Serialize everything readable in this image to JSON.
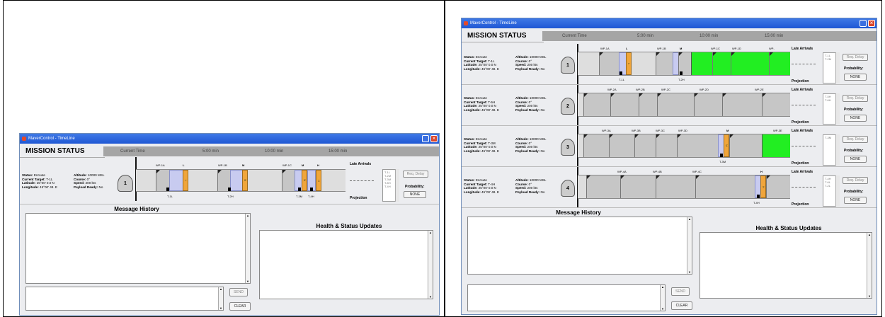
{
  "window_title": "MaverControl - TimeLine",
  "header": {
    "title": "MISSION STATUS",
    "time_labels": [
      "Current Time",
      "5:00 min",
      "10:00 min",
      "15:00 min"
    ]
  },
  "labels": {
    "late_arrivals": "Late Arrivals",
    "projection": "Projection",
    "req_delay": "Req. Delay",
    "probability": "Probability:",
    "none": "NONE",
    "message_history": "Message History",
    "health_status": "Health & Status Updates",
    "send": "SEND",
    "clear": "CLEAR",
    "status_k": "Status:",
    "target_k": "Current Target:",
    "lat_k": "Latitude:",
    "lon_k": "Longitude:",
    "alt_k": "Altitude:",
    "course_k": "Course:",
    "speed_k": "Speed:",
    "payload_k": "Payload Ready:"
  },
  "left_mission": {
    "number": "1",
    "status": "Enroute",
    "target": "T-1L",
    "lat": "25°00' 0.0 N",
    "lon": "45°00' 48. E",
    "alt": "10000 MSL",
    "course": "0°",
    "speed": "200 kts",
    "payload": "No",
    "waypoints": [
      "WP-1A",
      "L",
      "WP-1B",
      "M",
      "WP-1C",
      "M",
      "H"
    ],
    "targets": [
      "T-1L",
      "T-2H",
      "T-3M",
      "T-4H"
    ],
    "late_list": [
      "T-1L",
      "T-2M",
      "T-3M",
      "T-8H",
      "T-4H"
    ]
  },
  "right_missions": [
    {
      "number": "1",
      "status": "Enroute",
      "target": "T-1L",
      "lat": "25°00' 0.0 N",
      "lon": "45°00' 48. E",
      "alt": "10000 MSL",
      "course": "0°",
      "speed": "200 kts",
      "payload": "No",
      "waypoints": [
        "WP-1A",
        "L",
        "WP-1B",
        "M",
        "WP-1C",
        "WP-1D",
        "WP-"
      ],
      "targets": [
        "T-1L",
        "T-2H"
      ],
      "late_list": [
        "T-1L",
        "T-2M"
      ]
    },
    {
      "number": "2",
      "status": "Enroute",
      "target": "T-5H",
      "lat": "25°00' 0.0 N",
      "lon": "45°00' 48. E",
      "alt": "10000 MSL",
      "course": "0°",
      "speed": "200 kts",
      "payload": "No",
      "waypoints": [
        "WP-2A",
        "WP-2B",
        "WP-2C",
        "WP-2D",
        "WP-2E"
      ],
      "targets": [],
      "late_list": [
        "T-5H",
        "T-6H"
      ]
    },
    {
      "number": "3",
      "status": "Enroute",
      "target": "T-3M",
      "lat": "25°00' 0.0 N",
      "lon": "45°00' 48. E",
      "alt": "10000 MSL",
      "course": "0°",
      "speed": "200 kts",
      "payload": "No",
      "waypoints": [
        "WP-3A",
        "WP-3B",
        "WP-3C",
        "WP-3D",
        "M",
        "WP-3E"
      ],
      "targets": [
        "T-3M"
      ],
      "late_list": [
        "T-3M"
      ]
    },
    {
      "number": "4",
      "status": "Enroute",
      "target": "T-4H",
      "lat": "25°00' 0.0 N",
      "lon": "45°00' 48. E",
      "alt": "10000 MSL",
      "course": "0°",
      "speed": "200 kts",
      "payload": "No",
      "waypoints": [
        "WP-4A",
        "WP-4B",
        "WP-4C",
        "H"
      ],
      "targets": [
        "T-4H"
      ],
      "late_list": [
        "T-4H",
        "T-6L",
        "T-2L"
      ]
    }
  ]
}
